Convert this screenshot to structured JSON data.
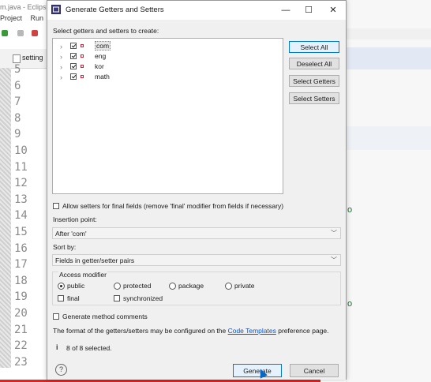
{
  "background": {
    "window_title": "m.java - Eclips",
    "menu": [
      "Project",
      "Run"
    ],
    "editor_tab": "setting",
    "line_numbers": [
      "5",
      "6",
      "7",
      "8",
      "9",
      "10",
      "11",
      "12",
      "13",
      "14",
      "15",
      "16",
      "17",
      "18",
      "19",
      "20",
      "21",
      "22",
      "23"
    ],
    "right_letter": "o"
  },
  "dialog": {
    "title": "Generate Getters and Setters",
    "minimize": "—",
    "maximize": "☐",
    "close": "✕",
    "select_label": "Select getters and setters to create:",
    "fields": [
      {
        "name": "com",
        "checked": true
      },
      {
        "name": "eng",
        "checked": true
      },
      {
        "name": "kor",
        "checked": true
      },
      {
        "name": "math",
        "checked": true
      }
    ],
    "buttons": {
      "select_all": "Select All",
      "deselect_all": "Deselect All",
      "select_getters": "Select Getters",
      "select_setters": "Select Setters"
    },
    "allow_setters_final": "Allow setters for final fields (remove 'final' modifier from fields if necessary)",
    "insertion_point_label": "Insertion point:",
    "insertion_point_value": "After 'com'",
    "sort_by_label": "Sort by:",
    "sort_by_value": "Fields in getter/setter pairs",
    "access_modifier": {
      "label": "Access modifier",
      "options": [
        "public",
        "protected",
        "package",
        "private"
      ],
      "selected": "public",
      "final_label": "final",
      "synchronized_label": "synchronized"
    },
    "generate_comments": "Generate method comments",
    "format_text_before": "The format of the getters/setters may be configured on the ",
    "format_link": "Code Templates",
    "format_text_after": " preference page.",
    "info_icon": "i",
    "selection_status": "8 of 8 selected.",
    "help_icon": "?",
    "generate_button": "Generate",
    "cancel_button": "Cancel"
  },
  "colors": {
    "accent_border": "#0078d7",
    "field_icon": "#d21f3c",
    "link": "#0b57c2",
    "progress_line": "#e2221f"
  }
}
